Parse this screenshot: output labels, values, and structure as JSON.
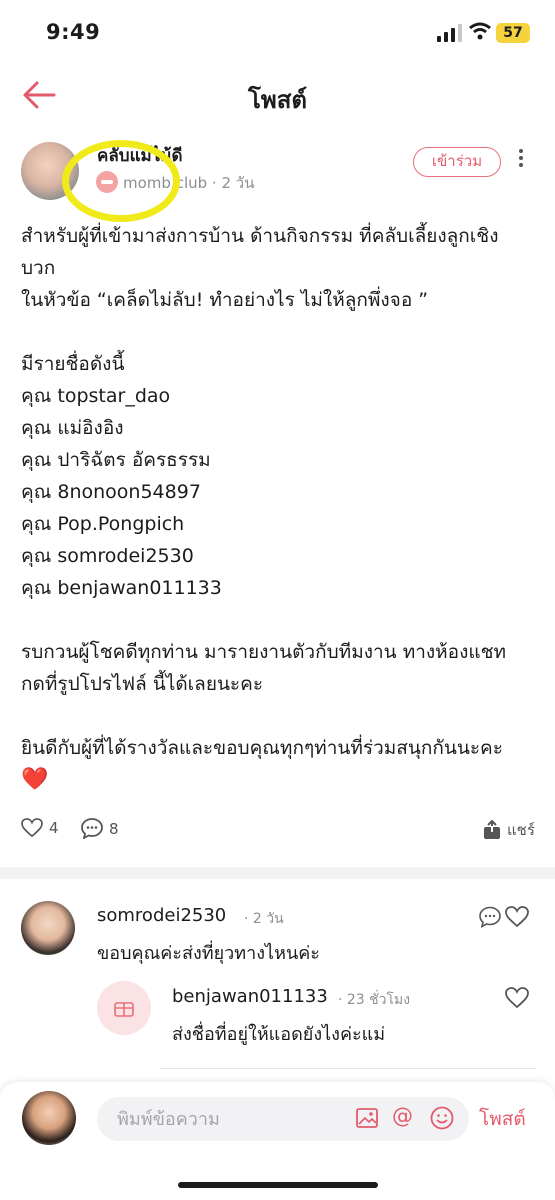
{
  "status_bar": {
    "time": "9:49",
    "battery": "57"
  },
  "nav": {
    "title": "โพสต์"
  },
  "post": {
    "author": "คลับแม่ไม้ดี",
    "club": "momb   club",
    "age": "· 2 วัน",
    "join_label": "เข้าร่วม",
    "lines": [
      "สำหรับผู้ที่เข้ามาส่งการบ้าน ด้านกิจกรรม ที่คลับเลี้ยงลูกเชิง",
      "บวก",
      "ในหัวข้อ “เคล็ดไม่ลับ! ทำอย่างไร ไม่ให้ลูกพึ่งจอ ”",
      "",
      "มีรายชื่อดังนี้",
      "คุณ topstar_dao",
      "คุณ แม่อิงอิง",
      "คุณ ปาริฉัตร อัครธรรม",
      "คุณ 8nonoon54897",
      "คุณ Pop.Pongpich",
      "คุณ somrodei2530",
      "คุณ benjawan011133",
      "",
      "รบกวนผู้โชคดีทุกท่าน มารายงานตัวกับทีมงาน ทางห้องแชท",
      "กดที่รูปโปรไฟล์ นี้ได้เลยนะคะ",
      "",
      "ยินดีกับผู้ที่ได้รางวัลและขอบคุณทุกๆท่านที่ร่วมสนุกกันนะคะ"
    ],
    "heart": "❤️",
    "likes": "4",
    "comments": "8",
    "share_label": "แชร์"
  },
  "comments": [
    {
      "user": "somrodei2530",
      "time": "· 2 วัน",
      "text": "ขอบคุณค่ะส่งที่ยุวทางไหนค่ะ"
    }
  ],
  "reply": {
    "user": "benjawan011133",
    "time": "· 23 ชั่วโมง",
    "text": "ส่งชื่อที่อยู่ให้แอดยังไงค่ะแม่"
  },
  "composer": {
    "placeholder": "พิมพ์ข้อความ",
    "at_symbol": "@",
    "post_label": "โพสต์"
  },
  "colors": {
    "accent": "#e35b6b",
    "highlight": "#f1ea1b"
  }
}
